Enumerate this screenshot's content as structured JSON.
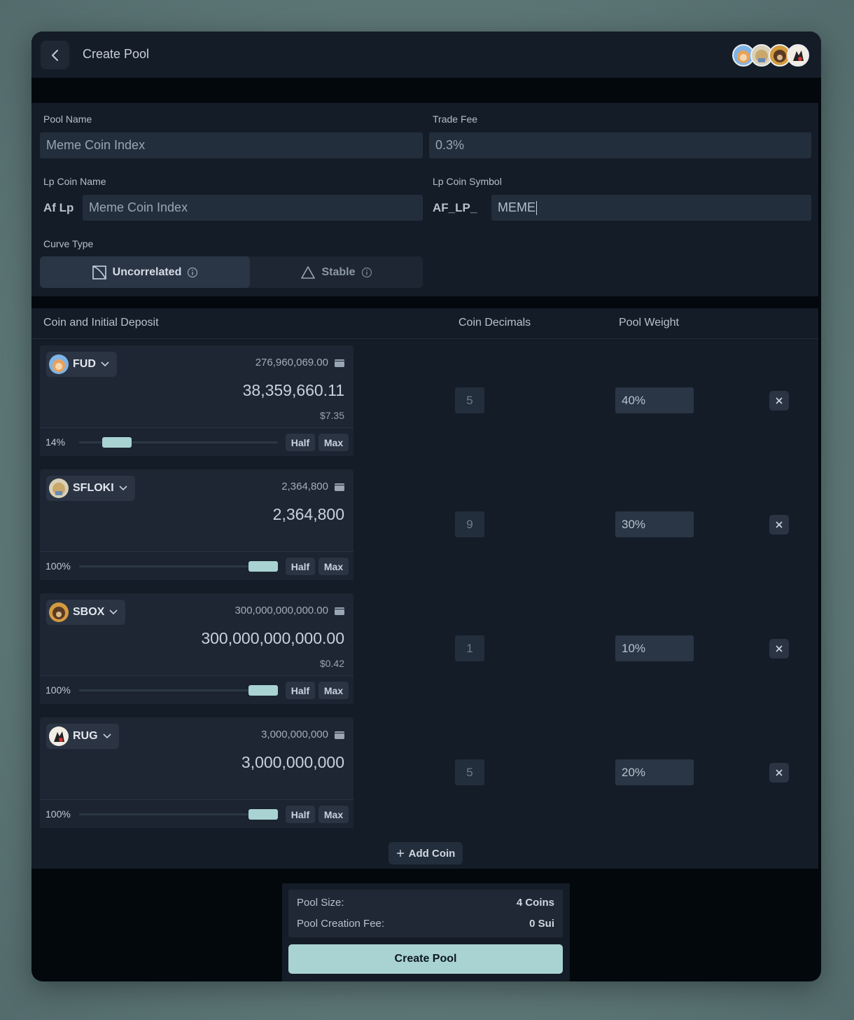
{
  "header": {
    "title": "Create Pool"
  },
  "form": {
    "pool_name_label": "Pool Name",
    "pool_name_value": "Meme Coin Index",
    "trade_fee_label": "Trade Fee",
    "trade_fee_value": "0.3%",
    "lp_coin_name_label": "Lp Coin Name",
    "lp_coin_name_prefix": "Af Lp",
    "lp_coin_name_value": "Meme Coin Index",
    "lp_coin_symbol_label": "Lp Coin Symbol",
    "lp_coin_symbol_prefix": "AF_LP_",
    "lp_coin_symbol_value": "MEME",
    "curve_type_label": "Curve Type",
    "curve_options": [
      {
        "label": "Uncorrelated",
        "selected": true,
        "icon": "square-diagonal-icon"
      },
      {
        "label": "Stable",
        "selected": false,
        "icon": "triangle-icon"
      }
    ]
  },
  "coins_table": {
    "headers": {
      "coin": "Coin and Initial Deposit",
      "decimals": "Coin Decimals",
      "weight": "Pool Weight"
    },
    "rows": [
      {
        "symbol": "FUD",
        "balance": "276,960,069.00",
        "amount": "38,359,660.11",
        "usd": "$7.35",
        "percent": "14%",
        "slider_fraction": 0.14,
        "half": "Half",
        "max": "Max",
        "decimals": "5",
        "weight": "40%"
      },
      {
        "symbol": "SFLOKI",
        "balance": "2,364,800",
        "amount": "2,364,800",
        "usd": "",
        "percent": "100%",
        "slider_fraction": 1.0,
        "half": "Half",
        "max": "Max",
        "decimals": "9",
        "weight": "30%"
      },
      {
        "symbol": "SBOX",
        "balance": "300,000,000,000.00",
        "amount": "300,000,000,000.00",
        "usd": "$0.42",
        "percent": "100%",
        "slider_fraction": 1.0,
        "half": "Half",
        "max": "Max",
        "decimals": "1",
        "weight": "10%"
      },
      {
        "symbol": "RUG",
        "balance": "3,000,000,000",
        "amount": "3,000,000,000",
        "usd": "",
        "percent": "100%",
        "slider_fraction": 1.0,
        "half": "Half",
        "max": "Max",
        "decimals": "5",
        "weight": "20%"
      }
    ],
    "add_coin_label": "Add Coin"
  },
  "summary": {
    "pool_size_label": "Pool Size:",
    "pool_size_value": "4 Coins",
    "creation_fee_label": "Pool Creation Fee:",
    "creation_fee_value": "0 Sui",
    "create_button": "Create Pool"
  },
  "colors": {
    "accent": "#a9d3d3",
    "panel": "#141c27",
    "field": "#232e3c"
  }
}
